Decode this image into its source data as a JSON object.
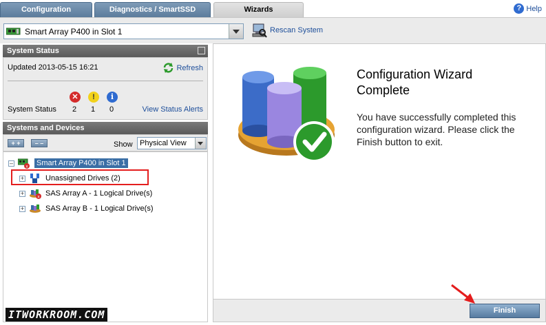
{
  "tabs": [
    {
      "label": "Configuration",
      "active": false
    },
    {
      "label": "Diagnostics / SmartSSD",
      "active": false
    },
    {
      "label": "Wizards",
      "active": true
    }
  ],
  "help": {
    "label": "Help",
    "icon": "help-icon"
  },
  "controller_select": {
    "value": "Smart Array P400 in Slot 1",
    "icon": "controller-card-icon"
  },
  "rescan": {
    "label": "Rescan System",
    "icon": "rescan-icon"
  },
  "system_status": {
    "title": "System Status",
    "updated": "Updated 2013-05-15 16:21",
    "refresh_label": "Refresh",
    "status_label": "System Status",
    "counts": [
      {
        "icon": "error-icon",
        "value": "2",
        "color": "#d42b2b"
      },
      {
        "icon": "warning-icon",
        "value": "1",
        "color": "#f2d21b"
      },
      {
        "icon": "info-icon",
        "value": "0",
        "color": "#2f6bd0"
      }
    ],
    "view_alerts_label": "View Status Alerts"
  },
  "systems_devices": {
    "title": "Systems and Devices",
    "expand_all_label": "+ +",
    "collapse_all_label": "– –",
    "show_label": "Show",
    "show_value": "Physical View",
    "tree": [
      {
        "label": "Smart Array P400 in Slot 1",
        "selected": true,
        "toggle": "–",
        "icon": "controller-error-icon"
      },
      {
        "label": "Unassigned Drives (2)",
        "selected": false,
        "toggle": "+",
        "icon": "unassigned-drives-icon"
      },
      {
        "label": "SAS Array A - 1 Logical Drive(s)",
        "selected": false,
        "toggle": "+",
        "icon": "array-error-icon"
      },
      {
        "label": "SAS Array B - 1 Logical Drive(s)",
        "selected": false,
        "toggle": "+",
        "icon": "array-icon"
      }
    ]
  },
  "wizard": {
    "title_line1": "Configuration Wizard",
    "title_line2": "Complete",
    "message": "You have successfully completed this configuration wizard. Please click the Finish button to exit.",
    "finish_label": "Finish",
    "illustration": "wizard-complete-icon"
  },
  "watermark": "ITWORKROOM.COM",
  "colors": {
    "tab_bg": "#6c8aa8",
    "panel_header": "#6a6a6a",
    "link": "#1d4e9a",
    "selection": "#3a6ea5",
    "highlight_box": "#e41d1d"
  }
}
